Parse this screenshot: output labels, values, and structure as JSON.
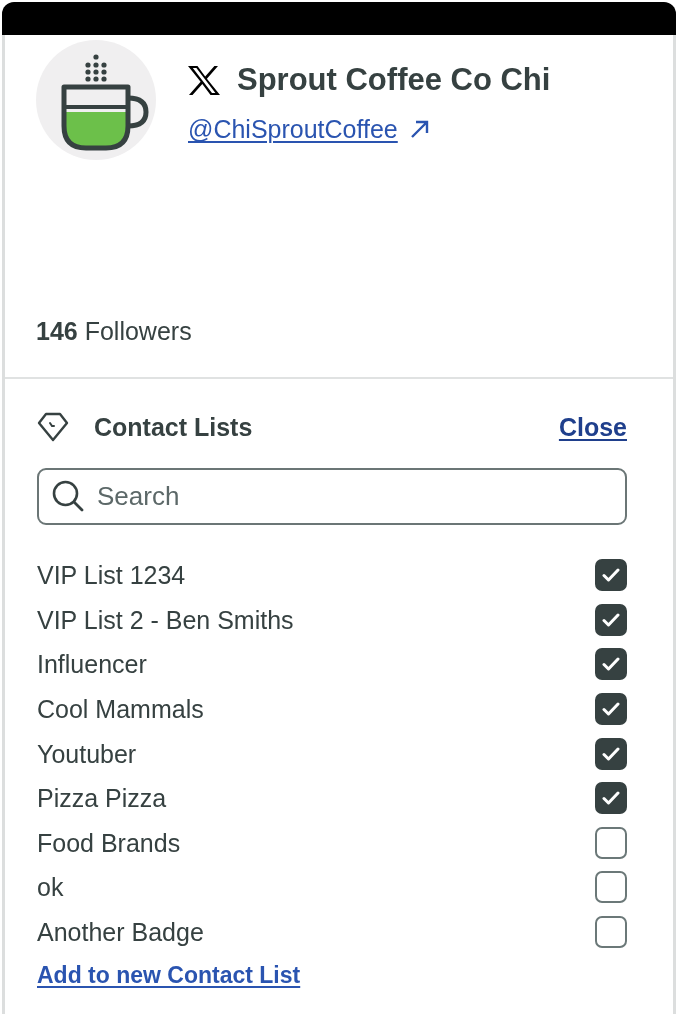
{
  "profile": {
    "name": "Sprout Coffee Co Chi",
    "handle": "@ChiSproutCoffee",
    "followers": "**146** Followers"
  },
  "contact_lists": {
    "title": "Contact Lists",
    "close": "Close",
    "search": {
      "placeholder": "Search"
    },
    "items": [
      {
        "label": "VIP List 1234",
        "checked": true
      },
      {
        "label": "VIP List 2 - Ben Smiths",
        "checked": true
      },
      {
        "label": "Influencer",
        "checked": true
      },
      {
        "label": "Cool Mammals",
        "checked": true
      },
      {
        "label": "Youtuber",
        "checked": true
      },
      {
        "label": "Pizza Pizza",
        "checked": true
      },
      {
        "label": "Food Brands",
        "checked": false
      },
      {
        "label": "ok",
        "checked": false
      },
      {
        "label": "Another Badge",
        "checked": false
      }
    ],
    "add_link": "Add to new Contact List"
  }
}
